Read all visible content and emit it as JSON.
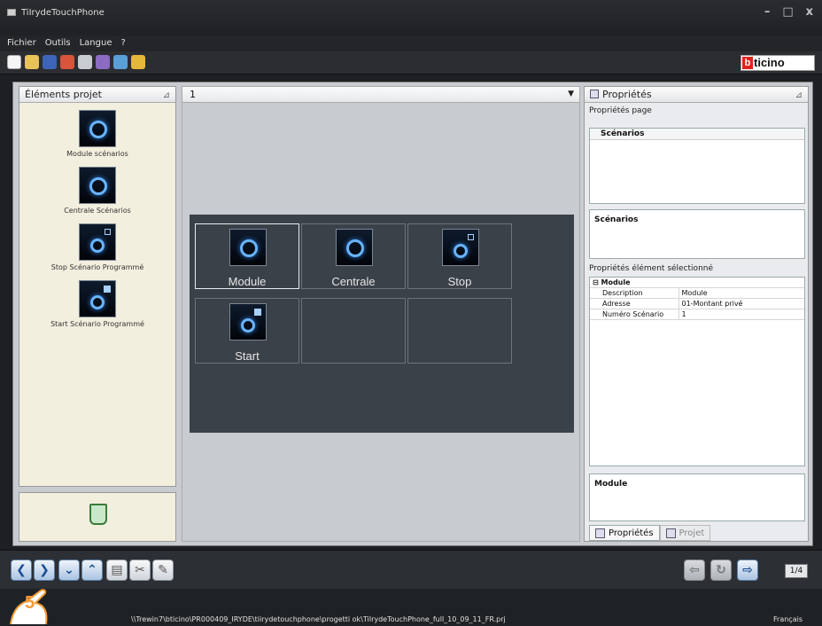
{
  "window": {
    "title": "TiIrydeTouchPhone"
  },
  "menu": [
    "Fichier",
    "Outils",
    "Langue",
    "?"
  ],
  "brand": {
    "logo_text": "ticino",
    "logo_letter": "b"
  },
  "left_panel": {
    "title": "Éléments projet",
    "items": [
      {
        "label": "Module scénarios",
        "icon": "scenario-module-icon"
      },
      {
        "label": "Centrale Scénarios",
        "icon": "scenario-central-icon"
      },
      {
        "label": "Stop Scénario Programmé",
        "icon": "stop-scenario-icon"
      },
      {
        "label": "Start Scénario Programmé",
        "icon": "start-scenario-icon"
      }
    ]
  },
  "page_selector": {
    "value": "1"
  },
  "canvas": {
    "cells": [
      {
        "label": "Module",
        "icon": "scenario-module-icon",
        "selected": true
      },
      {
        "label": "Centrale",
        "icon": "scenario-central-icon"
      },
      {
        "label": "Stop",
        "icon": "stop-scenario-icon"
      },
      {
        "label": "Start",
        "icon": "start-scenario-icon"
      },
      {
        "label": ""
      },
      {
        "label": ""
      }
    ]
  },
  "right_panel": {
    "title": "Propriétés",
    "page_props_label": "Propriétés page",
    "page_props_header": "Scénarios",
    "scenarios_box_title": "Scénarios",
    "selected_props_label": "Propriétés élément sélectionné",
    "group": "Module",
    "props": [
      {
        "key": "Description",
        "value": "Module"
      },
      {
        "key": "Adresse",
        "value": "01-Montant privé"
      },
      {
        "key": "Numéro Scénario",
        "value": "1"
      }
    ],
    "bottom_box_title": "Module",
    "tabs": [
      "Propriétés",
      "Projet"
    ]
  },
  "navigation": {
    "page_indicator": "1/4"
  },
  "status": {
    "path": "\\\\Trewin7\\bticino\\PR000409_IRYDE\\tiirydetouchphone\\progetti ok\\TiIrydeTouchPhone_full_10_09_11_FR.prj",
    "language": "Français"
  },
  "callout": {
    "number": "5"
  }
}
